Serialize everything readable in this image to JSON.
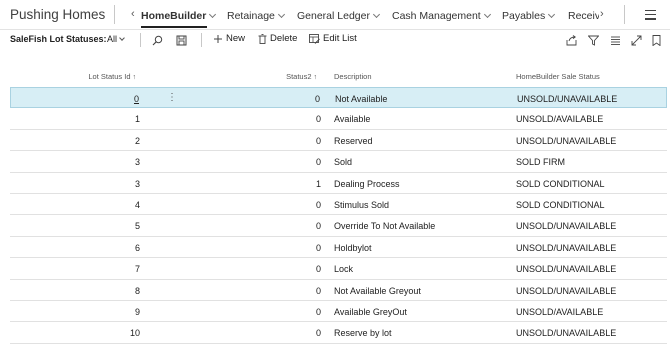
{
  "app": {
    "company": "Pushing Homes",
    "nav": [
      {
        "label": "HomeBuilder",
        "active": true
      },
      {
        "label": "Retainage",
        "active": false
      },
      {
        "label": "General Ledger",
        "active": false
      },
      {
        "label": "Cash Management",
        "active": false
      },
      {
        "label": "Payables",
        "active": false
      },
      {
        "label": "Receiv",
        "active": false
      }
    ]
  },
  "toolbar": {
    "view_label": "SaleFish Lot Statuses:",
    "view_value": "All",
    "new_label": "New",
    "delete_label": "Delete",
    "edit_list_label": "Edit List"
  },
  "table": {
    "columns": {
      "lot_status_id": "Lot Status Id",
      "status2": "Status2",
      "description": "Description",
      "hb_status": "HomeBuilder Sale Status"
    },
    "sort_arrow": "↑",
    "rows": [
      {
        "id": "0",
        "status2": "0",
        "description": "Not Available",
        "hb_status": "UNSOLD/UNAVAILABLE"
      },
      {
        "id": "1",
        "status2": "0",
        "description": "Available",
        "hb_status": "UNSOLD/AVAILABLE"
      },
      {
        "id": "2",
        "status2": "0",
        "description": "Reserved",
        "hb_status": "UNSOLD/UNAVAILABLE"
      },
      {
        "id": "3",
        "status2": "0",
        "description": "Sold",
        "hb_status": "SOLD FIRM"
      },
      {
        "id": "3",
        "status2": "1",
        "description": "Dealing Process",
        "hb_status": "SOLD CONDITIONAL"
      },
      {
        "id": "4",
        "status2": "0",
        "description": "Stimulus Sold",
        "hb_status": "SOLD CONDITIONAL"
      },
      {
        "id": "5",
        "status2": "0",
        "description": "Override To Not Available",
        "hb_status": "UNSOLD/UNAVAILABLE"
      },
      {
        "id": "6",
        "status2": "0",
        "description": "Holdbylot",
        "hb_status": "UNSOLD/UNAVAILABLE"
      },
      {
        "id": "7",
        "status2": "0",
        "description": "Lock",
        "hb_status": "UNSOLD/UNAVAILABLE"
      },
      {
        "id": "8",
        "status2": "0",
        "description": "Not Available Greyout",
        "hb_status": "UNSOLD/UNAVAILABLE"
      },
      {
        "id": "9",
        "status2": "0",
        "description": "Available GreyOut",
        "hb_status": "UNSOLD/AVAILABLE"
      },
      {
        "id": "10",
        "status2": "0",
        "description": "Reserve by lot",
        "hb_status": "UNSOLD/UNAVAILABLE"
      }
    ],
    "selected_index": 0,
    "row_menu": "⋮"
  },
  "colors": {
    "selected_row_bg": "#d7eef5",
    "selected_row_border": "#a9d2e1"
  }
}
